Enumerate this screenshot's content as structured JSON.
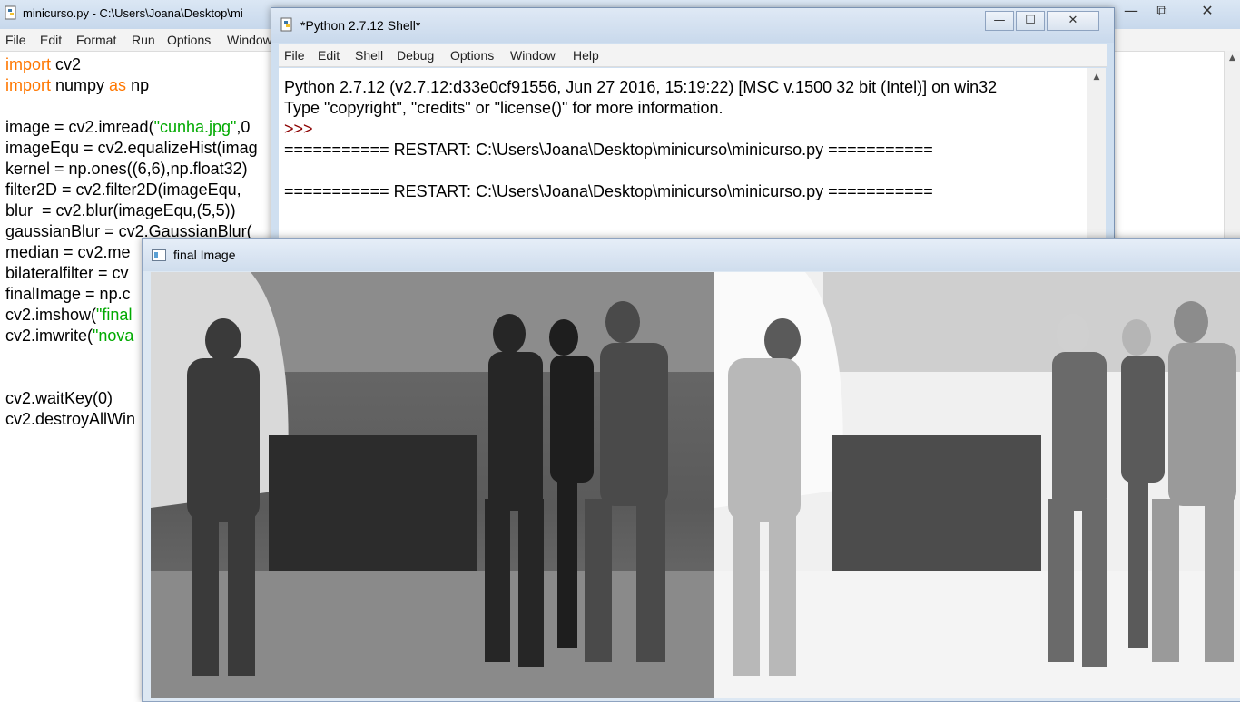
{
  "editor": {
    "title": "minicurso.py - C:\\Users\\Joana\\Desktop\\mi",
    "menu": [
      "File",
      "Edit",
      "Format",
      "Run",
      "Options",
      "Window"
    ],
    "window_controls": {
      "minimize": "—",
      "maximize": "⧉",
      "close": "✕"
    },
    "code_lines": [
      [
        {
          "t": "import",
          "c": "kw"
        },
        {
          "t": " cv2"
        }
      ],
      [
        {
          "t": "import",
          "c": "kw"
        },
        {
          "t": " numpy "
        },
        {
          "t": "as",
          "c": "kw"
        },
        {
          "t": " np"
        }
      ],
      [],
      [
        {
          "t": "image = cv2.imread("
        },
        {
          "t": "\"cunha.jpg\"",
          "c": "str"
        },
        {
          "t": ",0"
        }
      ],
      [
        {
          "t": "imageEqu = cv2.equalizeHist(imag"
        }
      ],
      [
        {
          "t": "kernel = np.ones((6,6),np.float32)"
        }
      ],
      [
        {
          "t": "filter2D = cv2.filter2D(imageEqu,"
        }
      ],
      [
        {
          "t": "blur  = cv2.blur(imageEqu,(5,5))"
        }
      ],
      [
        {
          "t": "gaussianBlur = cv2.GaussianBlur("
        }
      ],
      [
        {
          "t": "median = cv2.me"
        }
      ],
      [
        {
          "t": "bilateralfilter = cv"
        }
      ],
      [
        {
          "t": "finalImage = np.c"
        }
      ],
      [
        {
          "t": "cv2.imshow("
        },
        {
          "t": "\"final",
          "c": "str"
        }
      ],
      [
        {
          "t": "cv2.imwrite("
        },
        {
          "t": "\"nova",
          "c": "str"
        }
      ],
      [],
      [],
      [
        {
          "t": "cv2.waitKey(0)"
        }
      ],
      [
        {
          "t": "cv2.destroyAllWin"
        }
      ]
    ]
  },
  "shell": {
    "title": "*Python 2.7.12 Shell*",
    "menu": [
      "File",
      "Edit",
      "Shell",
      "Debug",
      "Options",
      "Window",
      "Help"
    ],
    "controls": {
      "minimize": "—",
      "maximize": "☐",
      "close": "✕"
    },
    "lines": {
      "l1": "Python 2.7.12 (v2.7.12:d33e0cf91556, Jun 27 2016, 15:19:22) [MSC v.1500 32 bit (Intel)] on win32",
      "l2": "Type \"copyright\", \"credits\" or \"license()\" for more information.",
      "prompt": ">>> ",
      "restart1": "=========== RESTART: C:\\Users\\Joana\\Desktop\\minicurso\\minicurso.py ===========",
      "restart2": "=========== RESTART: C:\\Users\\Joana\\Desktop\\minicurso\\minicurso.py ==========="
    },
    "scroll_arrow": "▲"
  },
  "image_window": {
    "title": "final Image",
    "panels": [
      {
        "name": "equalized-photo",
        "tone": "#5c5c5c"
      },
      {
        "name": "filtered-photo",
        "tone": "#e8e8e8"
      }
    ]
  }
}
